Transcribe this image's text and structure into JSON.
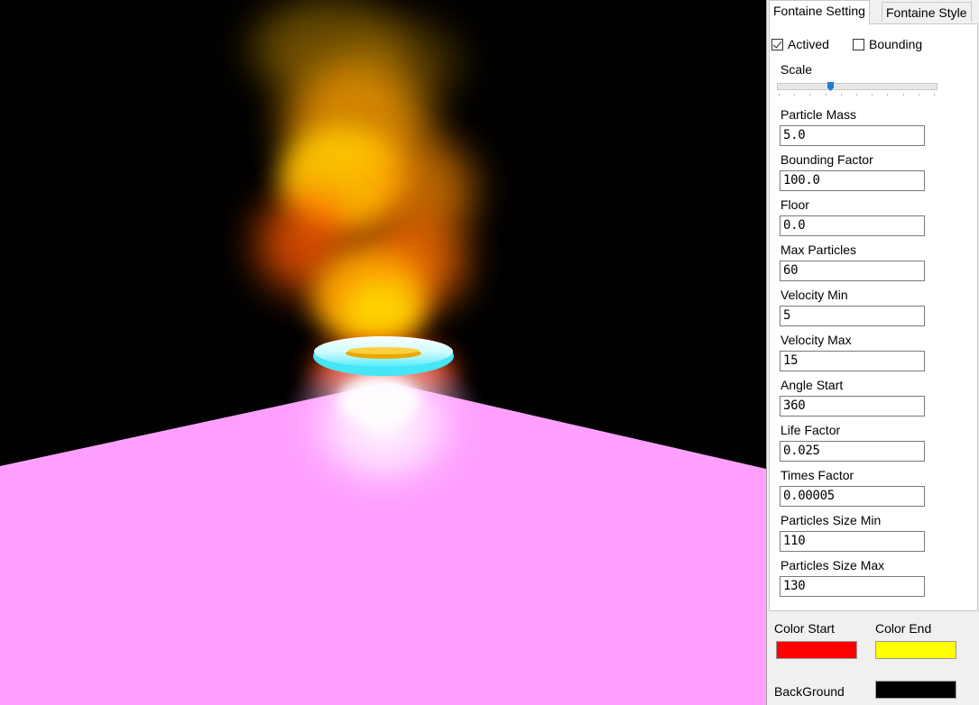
{
  "tabs": [
    {
      "label": "Fontaine Setting",
      "active": true
    },
    {
      "label": "Fontaine Style",
      "active": false
    }
  ],
  "options": {
    "actived": {
      "label": "Actived",
      "checked": true
    },
    "bounding": {
      "label": "Bounding",
      "checked": false
    }
  },
  "scale": {
    "label": "Scale",
    "value_fraction": 0.33
  },
  "fields": [
    {
      "label": "Particle Mass",
      "value": "5.0"
    },
    {
      "label": "Bounding Factor",
      "value": "100.0"
    },
    {
      "label": "Floor",
      "value": "0.0"
    },
    {
      "label": "Max Particles",
      "value": "60"
    },
    {
      "label": "Velocity Min",
      "value": "5"
    },
    {
      "label": "Velocity Max",
      "value": "15"
    },
    {
      "label": "Angle Start",
      "value": "360"
    },
    {
      "label": "Life Factor",
      "value": "0.025"
    },
    {
      "label": "Times Factor",
      "value": "0.00005"
    },
    {
      "label": "Particles Size Min",
      "value": "110"
    },
    {
      "label": "Particles Size Max",
      "value": "130"
    }
  ],
  "colors": {
    "start": {
      "label": "Color Start",
      "color": "#ff0000"
    },
    "end": {
      "label": "Color End",
      "color": "#ffff00"
    },
    "background": {
      "label": "BackGround",
      "color": "#000000"
    }
  },
  "scene": {
    "floor_color": "#ffa0ff",
    "ring_color": "#7ff6ff",
    "flame_colors": [
      "#ff4a00",
      "#ff9a00",
      "#ffd800"
    ]
  }
}
